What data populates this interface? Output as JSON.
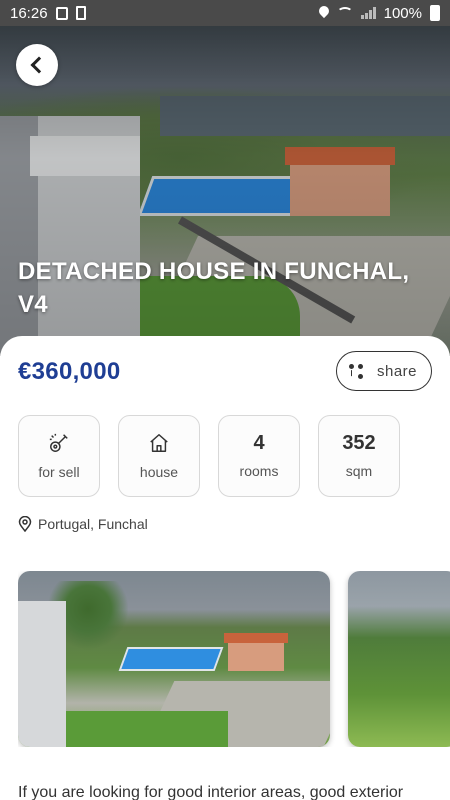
{
  "status_bar": {
    "time": "16:26",
    "battery": "100%"
  },
  "hero": {
    "title": "DETACHED HOUSE IN FUNCHAL, V4",
    "back_icon": "chevron-left-icon"
  },
  "listing": {
    "price": "€360,000",
    "share_label": "share",
    "features": [
      {
        "icon": "guitar-icon",
        "label": "for sell"
      },
      {
        "icon": "house-icon",
        "label": "house"
      },
      {
        "value": "4",
        "label": "rooms"
      },
      {
        "value": "352",
        "label": "sqm"
      }
    ],
    "location": "Portugal, Funchal",
    "description": "If you are looking for good interior areas, good exterior"
  },
  "colors": {
    "price": "#1f3e94",
    "status_bar": "#4a4a4a"
  }
}
